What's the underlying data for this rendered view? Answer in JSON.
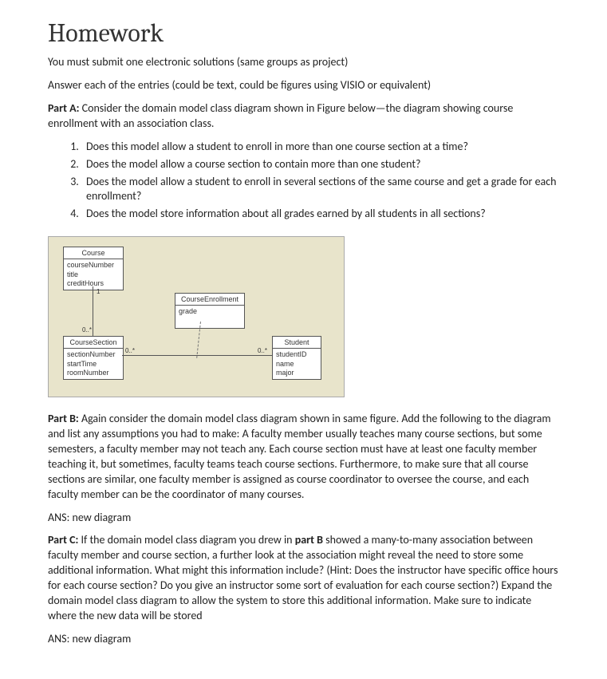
{
  "title": "Homework",
  "intro1": "You must submit one electronic solutions (same groups as project)",
  "intro2": "Answer each of the entries (could be text, could be figures using VISIO or equivalent)",
  "partA": {
    "label": "Part A:",
    "text": " Consider the domain model class diagram shown in Figure below—the diagram showing course enrollment with an association class.",
    "questions": [
      "Does this model allow a student to enroll in more than one course section at a time?",
      "Does the model allow a course section to contain more than one student?",
      "Does the model allow a student to enroll in several sections of the same course and get a grade for each enrollment?",
      "Does the model store information about all grades earned by all students in all sections?"
    ]
  },
  "diagram": {
    "course": {
      "name": "Course",
      "a1": "courseNumber",
      "a2": "title",
      "a3": "creditHours"
    },
    "enrollment": {
      "name": "CourseEnrollment",
      "a1": "grade"
    },
    "section": {
      "name": "CourseSection",
      "a1": "sectionNumber",
      "a2": "startTime",
      "a3": "roomNumber"
    },
    "student": {
      "name": "Student",
      "a1": "studentID",
      "a2": "name",
      "a3": "major"
    },
    "m1": "1",
    "m0s_a": "0..*",
    "m0s_b": "0..*",
    "m0s_c": "0..*"
  },
  "partB": {
    "label": "Part B:",
    "text": " Again consider the domain model class diagram shown in same figure. Add the following to the diagram and list any assumptions you had to make: A faculty member usually teaches many course sections, but some semesters, a faculty member may not teach any. Each course section must have at least one faculty member teaching it, but sometimes, faculty teams teach course sections. Furthermore, to make sure that all course sections are similar, one faculty member is assigned as course coordinator to oversee the course, and each faculty member can be the coordinator of many courses.",
    "ans": "ANS: new diagram"
  },
  "partC": {
    "label": "Part C:",
    "prebold": " If the domain model class diagram you drew in ",
    "bold": "part B",
    "postbold": " showed a many-to-many association between faculty member and course section, a further look at the association might reveal the need to store some additional information. What might this information include? (Hint: Does the instructor have specific office hours for each course section? Do you give an instructor some sort of evaluation for each course section?) Expand the domain model class diagram to allow the system to store this additional information. Make sure to indicate where the new data will be stored",
    "ans": "ANS: new diagram"
  }
}
